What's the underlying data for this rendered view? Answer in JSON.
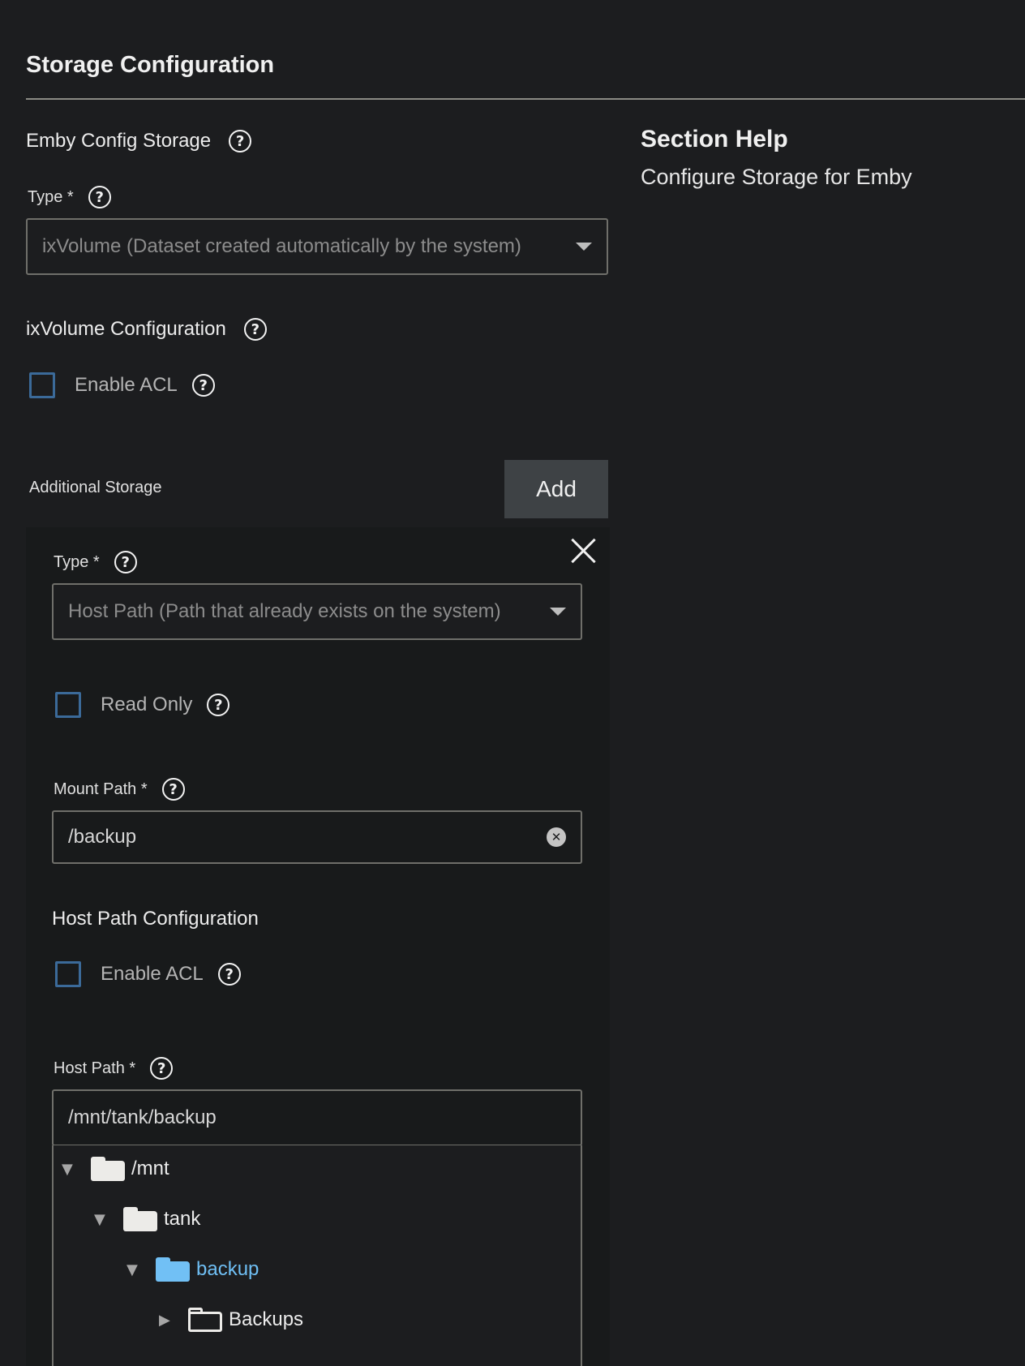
{
  "header": {
    "title": "Storage Configuration"
  },
  "config_storage": {
    "label": "Emby Config Storage",
    "type_label": "Type *",
    "type_value": "ixVolume (Dataset created automatically by the system)",
    "ixvolume_label": "ixVolume Configuration",
    "enable_acl_label": "Enable ACL"
  },
  "additional_storage": {
    "label": "Additional Storage",
    "add_label": "Add",
    "item": {
      "type_label": "Type *",
      "type_value": "Host Path (Path that already exists on the system)",
      "read_only_label": "Read Only",
      "mount_path_label": "Mount Path *",
      "mount_path_value": "/backup",
      "host_path_config_label": "Host Path Configuration",
      "enable_acl_label": "Enable ACL",
      "host_path_label": "Host Path *",
      "host_path_value": "/mnt/tank/backup",
      "tree": [
        {
          "toggle": "▼",
          "icon": "folder-icon",
          "label": "/mnt"
        },
        {
          "toggle": "▼",
          "icon": "folder-icon",
          "label": "tank"
        },
        {
          "toggle": "▼",
          "icon": "folder-icon",
          "label": "backup"
        },
        {
          "toggle": "▶",
          "icon": "folder-outline-icon",
          "label": "Backups"
        }
      ]
    }
  },
  "section_help": {
    "title": "Section Help",
    "text": "Configure Storage for Emby"
  },
  "colors": {
    "background": "#1c1d1f",
    "panel": "#181a1b",
    "accent": "#6fbff4",
    "checkbox_border": "#3b6a99",
    "button": "#3e4245"
  }
}
